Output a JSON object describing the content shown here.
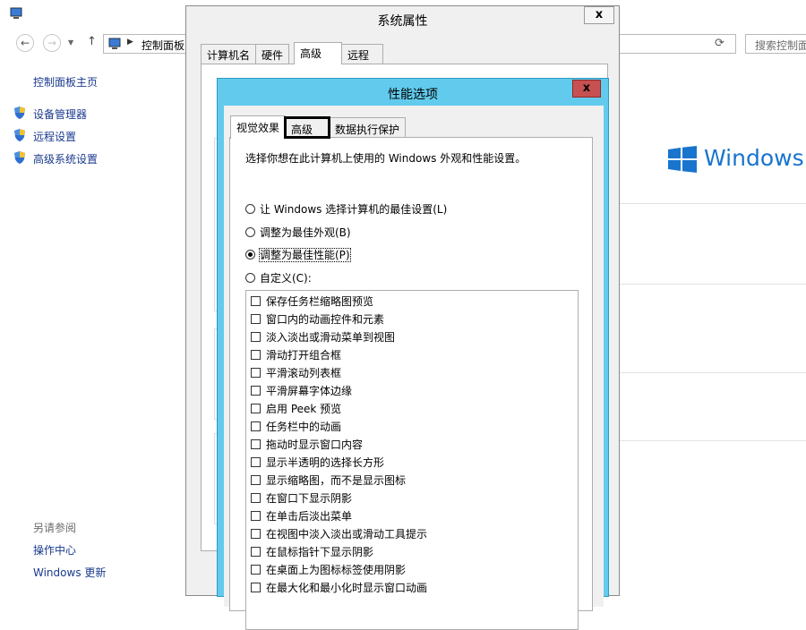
{
  "background": {
    "address_text": "控制面板",
    "search_placeholder": "搜索控制面",
    "home_link": "控制面板主页",
    "links": [
      "设备管理器",
      "远程设置",
      "高级系统设置"
    ],
    "see_also_heading": "另请参阅",
    "see_also_links": [
      "操作中心",
      "Windows 更新"
    ],
    "brand_text": "Windows Se"
  },
  "system_properties": {
    "title": "系统属性",
    "close_label": "x",
    "tabs": [
      "计算机名",
      "硬件",
      "高级",
      "远程"
    ],
    "active_tab": "高级"
  },
  "performance_options": {
    "title": "性能选项",
    "close_label": "x",
    "tabs": [
      "视觉效果",
      "高级",
      "数据执行保护"
    ],
    "active_tab": "视觉效果",
    "description": "选择你想在此计算机上使用的 Windows 外观和性能设置。",
    "radios": [
      {
        "label": "让 Windows 选择计算机的最佳设置(L)",
        "checked": false
      },
      {
        "label": "调整为最佳外观(B)",
        "checked": false
      },
      {
        "label": "调整为最佳性能(P)",
        "checked": true
      },
      {
        "label": "自定义(C):",
        "checked": false
      }
    ],
    "options": [
      "保存任务栏缩略图预览",
      "窗口内的动画控件和元素",
      "淡入淡出或滑动菜单到视图",
      "滑动打开组合框",
      "平滑滚动列表框",
      "平滑屏幕字体边缘",
      "启用 Peek 预览",
      "任务栏中的动画",
      "拖动时显示窗口内容",
      "显示半透明的选择长方形",
      "显示缩略图，而不是显示图标",
      "在窗口下显示阴影",
      "在单击后淡出菜单",
      "在视图中淡入淡出或滑动工具提示",
      "在鼠标指针下显示阴影",
      "在桌面上为图标标签使用阴影",
      "在最大化和最小化时显示窗口动画"
    ]
  },
  "colors": {
    "accent": "#62cbed",
    "close_red": "#c75050",
    "link_blue": "#1a3a8c",
    "windows_blue": "#1874cd"
  }
}
